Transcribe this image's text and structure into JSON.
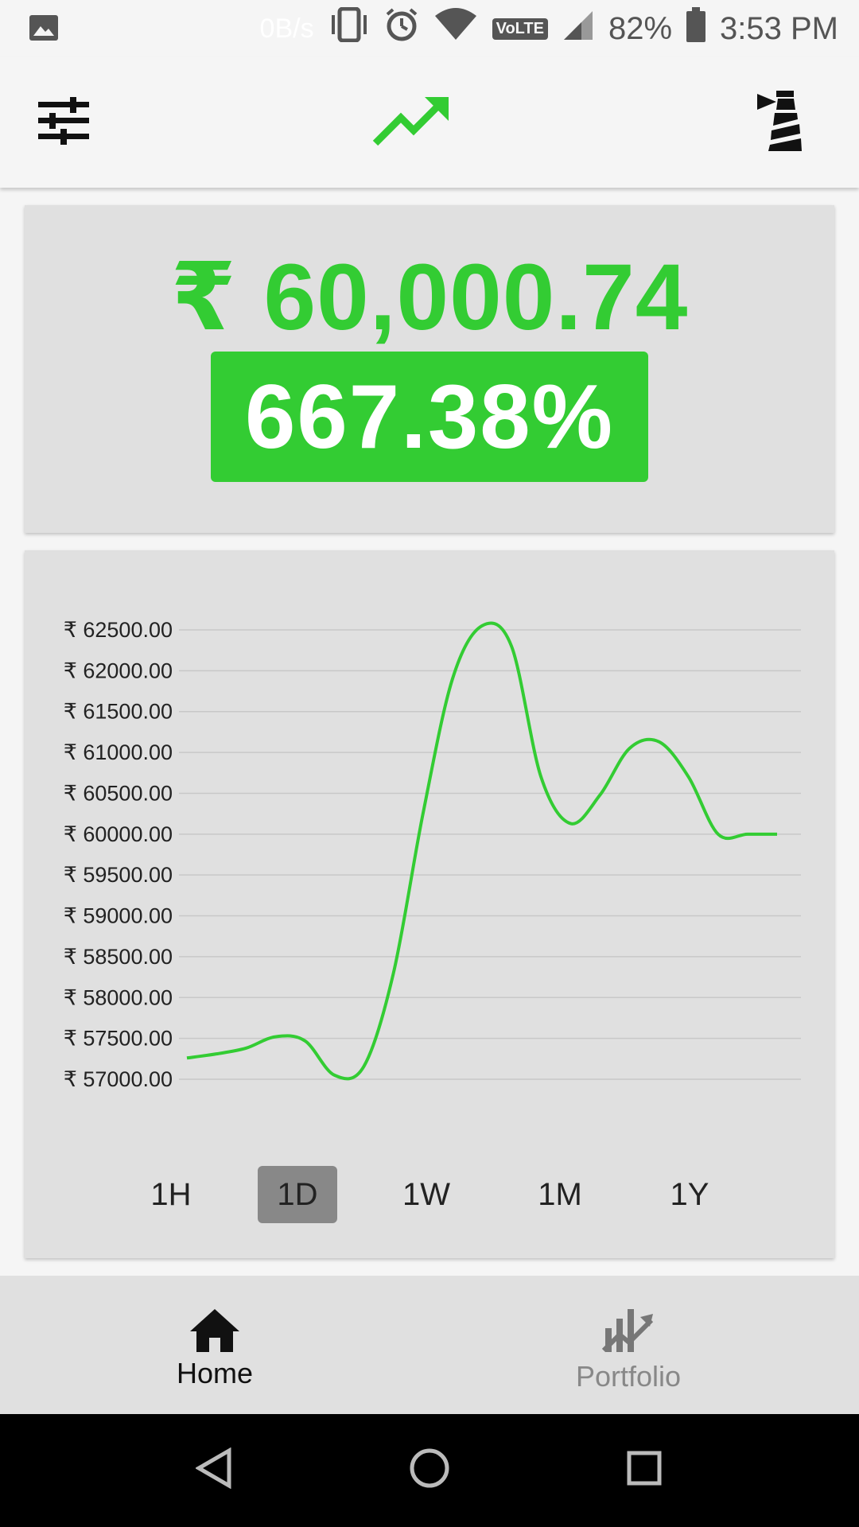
{
  "status_bar": {
    "speed": "0B/s",
    "volte": "VoLTE",
    "battery": "82%",
    "time": "3:53 PM"
  },
  "app_bar": {
    "left_icon": "tune-icon",
    "center_icon": "trending-up-icon",
    "right_icon": "lighthouse-icon",
    "accent_color": "#33cc33"
  },
  "price_card": {
    "price": "₹ 60,000.74",
    "change": "667.38%"
  },
  "chart_data": {
    "type": "line",
    "x": [
      0,
      1,
      2,
      3,
      4,
      5,
      6,
      7,
      8,
      9,
      10,
      11,
      12,
      13,
      14,
      15,
      16,
      17,
      18,
      19,
      20
    ],
    "series": [
      {
        "values": [
          57260,
          57310,
          57380,
          57520,
          57470,
          57050,
          57160,
          58300,
          60250,
          61900,
          62550,
          62300,
          60700,
          60130,
          60480,
          61050,
          61130,
          60700,
          60000,
          60000,
          60000
        ]
      }
    ],
    "y_ticks": [
      "₹ 62500.00",
      "₹ 62000.00",
      "₹ 61500.00",
      "₹ 61000.00",
      "₹ 60500.00",
      "₹ 60000.00",
      "₹ 59500.00",
      "₹ 59000.00",
      "₹ 58500.00",
      "₹ 58000.00",
      "₹ 57500.00",
      "₹ 57000.00"
    ],
    "ylim": [
      57000,
      62500
    ],
    "grid": true,
    "color": "#33cc33"
  },
  "range_selector": {
    "options": [
      "1H",
      "1D",
      "1W",
      "1M",
      "1Y"
    ],
    "selected": "1D"
  },
  "bottom_nav": {
    "home_label": "Home",
    "portfolio_label": "Portfolio",
    "active": "Home"
  }
}
